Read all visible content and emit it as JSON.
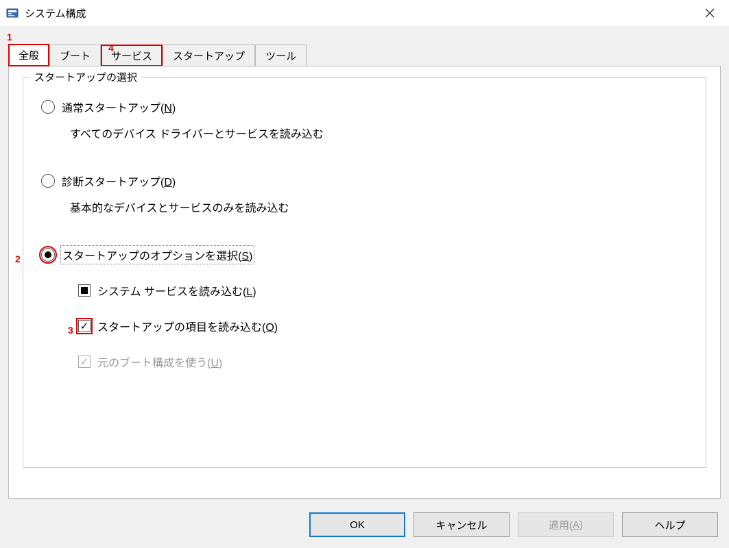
{
  "window": {
    "title": "システム構成"
  },
  "tabs": {
    "general": "全般",
    "boot": "ブート",
    "services": "サービス",
    "startup": "スタートアップ",
    "tools": "ツール"
  },
  "group": {
    "title": "スタートアップの選択",
    "normal": {
      "label": "通常スタートアップ(",
      "accel": "N",
      "label_after": ")",
      "desc": "すべてのデバイス ドライバーとサービスを読み込む"
    },
    "diagnostic": {
      "label": "診断スタートアップ(",
      "accel": "D",
      "label_after": ")",
      "desc": "基本的なデバイスとサービスのみを読み込む"
    },
    "selective": {
      "label": "スタートアップのオプションを選択(",
      "accel": "S",
      "label_after": ")"
    },
    "chk_sysservices": {
      "label": "システム サービスを読み込む(",
      "accel": "L",
      "label_after": ")"
    },
    "chk_startupitems": {
      "label": "スタートアップの項目を読み込む(",
      "accel": "O",
      "label_after": ")"
    },
    "chk_origboot": {
      "label": "元のブート構成を使う(",
      "accel": "U",
      "label_after": ")"
    }
  },
  "buttons": {
    "ok": "OK",
    "cancel": "キャンセル",
    "apply": "適用(",
    "apply_accel": "A",
    "apply_after": ")",
    "help": "ヘルプ"
  },
  "annotations": {
    "n1": "1",
    "n2": "2",
    "n3": "3",
    "n4": "4"
  }
}
